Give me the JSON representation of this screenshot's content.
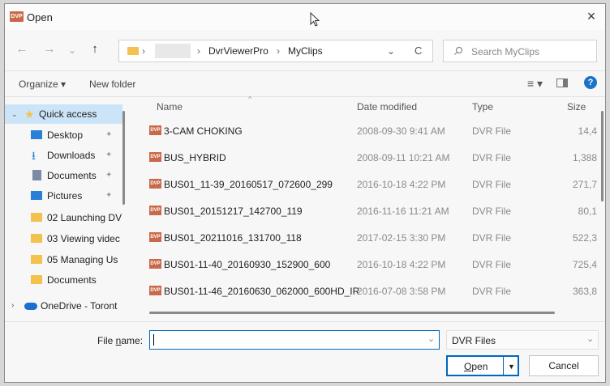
{
  "window": {
    "title": "Open",
    "app_badge": "DVP"
  },
  "nav": {
    "back": "←",
    "forward": "→",
    "recent": "⌄",
    "up": "↑",
    "refresh": "C",
    "dropdown": "⌄"
  },
  "address": {
    "crumbs": [
      "DvrViewerPro",
      "MyClips"
    ],
    "separator": "›"
  },
  "search": {
    "placeholder": "Search MyClips"
  },
  "toolbar": {
    "organize": "Organize ▾",
    "new_folder": "New folder"
  },
  "sidebar": {
    "items": [
      {
        "label": "Quick access",
        "icon": "star-icon",
        "color": "#f2c14e"
      },
      {
        "label": "Desktop",
        "icon": "desktop-icon",
        "color": "#2a7fd6"
      },
      {
        "label": "Downloads",
        "icon": "download-icon",
        "color": "#2a7fd6"
      },
      {
        "label": "Documents",
        "icon": "documents-icon",
        "color": "#7a8ba8"
      },
      {
        "label": "Pictures",
        "icon": "pictures-icon",
        "color": "#2a7fd6"
      },
      {
        "label": "02 Launching DV",
        "icon": "folder-icon",
        "color": "#f2c14e"
      },
      {
        "label": "03 Viewing videc",
        "icon": "folder-icon",
        "color": "#f2c14e"
      },
      {
        "label": "05 Managing Us",
        "icon": "folder-icon",
        "color": "#f2c14e"
      },
      {
        "label": "Documents",
        "icon": "folder-icon",
        "color": "#f2c14e"
      },
      {
        "label": "OneDrive - Toront",
        "icon": "cloud-icon",
        "color": "#1a6fd1"
      }
    ]
  },
  "columns": {
    "name": "Name",
    "date": "Date modified",
    "type": "Type",
    "size": "Size"
  },
  "files": [
    {
      "name": "3-CAM CHOKING",
      "date": "2008-09-30 9:41 AM",
      "type": "DVR File",
      "size": "14,4"
    },
    {
      "name": "BUS_HYBRID",
      "date": "2008-09-11 10:21 AM",
      "type": "DVR File",
      "size": "1,388"
    },
    {
      "name": "BUS01_11-39_20160517_072600_299",
      "date": "2016-10-18 4:22 PM",
      "type": "DVR File",
      "size": "271,7"
    },
    {
      "name": "BUS01_20151217_142700_119",
      "date": "2016-11-16 11:21 AM",
      "type": "DVR File",
      "size": "80,1"
    },
    {
      "name": "BUS01_20211016_131700_118",
      "date": "2017-02-15 3:30 PM",
      "type": "DVR File",
      "size": "522,3"
    },
    {
      "name": "BUS01-11-40_20160930_152900_600",
      "date": "2016-10-18 4:22 PM",
      "type": "DVR File",
      "size": "725,4"
    },
    {
      "name": "BUS01-11-46_20160630_062000_600HD_IR",
      "date": "2016-07-08 3:58 PM",
      "type": "DVR File",
      "size": "363,8"
    }
  ],
  "footer": {
    "filename_label_pre": "File ",
    "filename_label_u": "n",
    "filename_label_post": "ame:",
    "filename_value": "",
    "filter": "DVR Files",
    "open_u": "O",
    "open_rest": "pen",
    "cancel": "Cancel"
  },
  "colors": {
    "accent": "#0067c0",
    "selection": "#cce4f7",
    "file_icon": "#c9694a"
  }
}
